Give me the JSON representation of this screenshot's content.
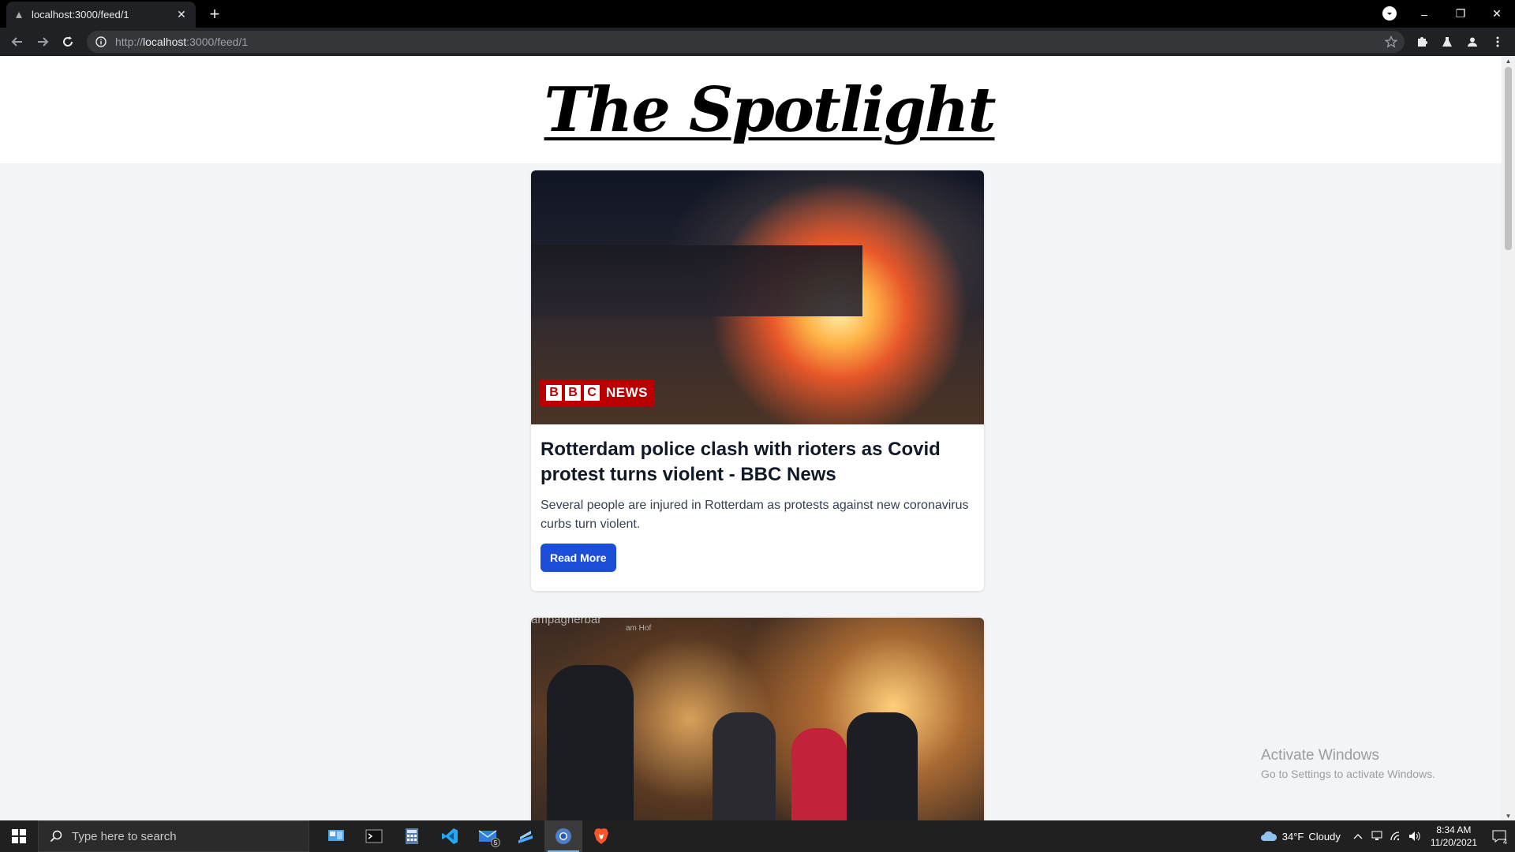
{
  "browser": {
    "tab_title": "localhost:3000/feed/1",
    "close_tab": "✕",
    "new_tab": "+",
    "url_scheme": "http://",
    "url_host": "localhost",
    "url_rest": ":3000/feed/1",
    "window_controls": [
      "–",
      "❐",
      "✕"
    ]
  },
  "site": {
    "logo": "The Spotlight"
  },
  "feed": {
    "articles": [
      {
        "source_badge_letters": [
          "B",
          "B",
          "C"
        ],
        "source_badge_word": "NEWS",
        "title": "Rotterdam police clash with rioters as Covid protest turns violent - BBC News",
        "description": "Several people are injured in Rotterdam as protests against new coronavirus curbs turn violent.",
        "button": "Read More"
      },
      {
        "image_sign": "ampagnerbar",
        "image_sign2": "am Hof"
      }
    ]
  },
  "watermark": {
    "line1": "Activate Windows",
    "line2": "Go to Settings to activate Windows."
  },
  "taskbar": {
    "search_placeholder": "Type here to search",
    "mail_badge": "5",
    "weather_temp": "34°F",
    "weather_text": "Cloudy",
    "time": "8:34 AM",
    "date": "11/20/2021",
    "notifications": "4"
  },
  "colors": {
    "accent_button": "#1d4ed8",
    "bbc_red": "#b80000",
    "page_bg": "#f3f4f6"
  }
}
